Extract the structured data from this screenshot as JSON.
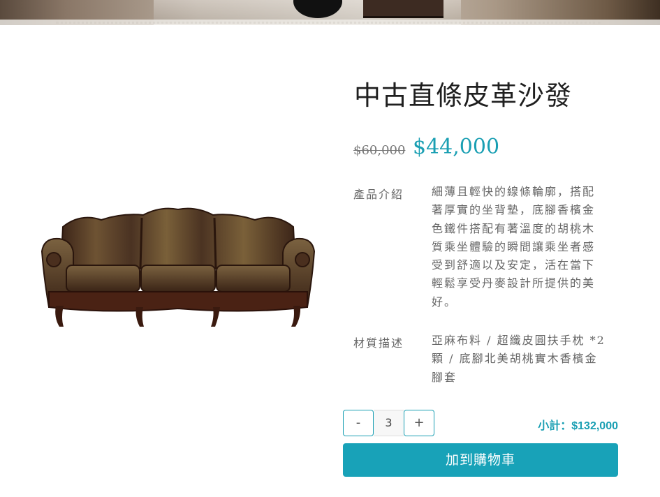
{
  "product": {
    "title": "中古直條皮革沙發",
    "original_price": "$60,000",
    "sale_price": "$44,000",
    "intro_label": "產品介紹",
    "intro_text": "細薄且輕快的線條輪廓，搭配著厚實的坐背墊，底腳香檳金色鐵件搭配有著溫度的胡桃木質乘坐體驗的瞬間讓乘坐者感受到舒適以及安定，活在當下輕鬆享受丹麥設計所提供的美好。",
    "material_label": "材質描述",
    "material_text": "亞麻布料 / 超纖皮圓扶手枕 *2顆 / 底腳北美胡桃實木香檳金腳套"
  },
  "cart": {
    "minus_label": "-",
    "quantity": "3",
    "plus_label": "+",
    "subtotal": "小計：$132,000",
    "add_to_cart_label": "加到購物車"
  },
  "colors": {
    "accent": "#18a2b8",
    "text": "#666666"
  },
  "icons": {
    "product_image": "leather-sofa"
  }
}
